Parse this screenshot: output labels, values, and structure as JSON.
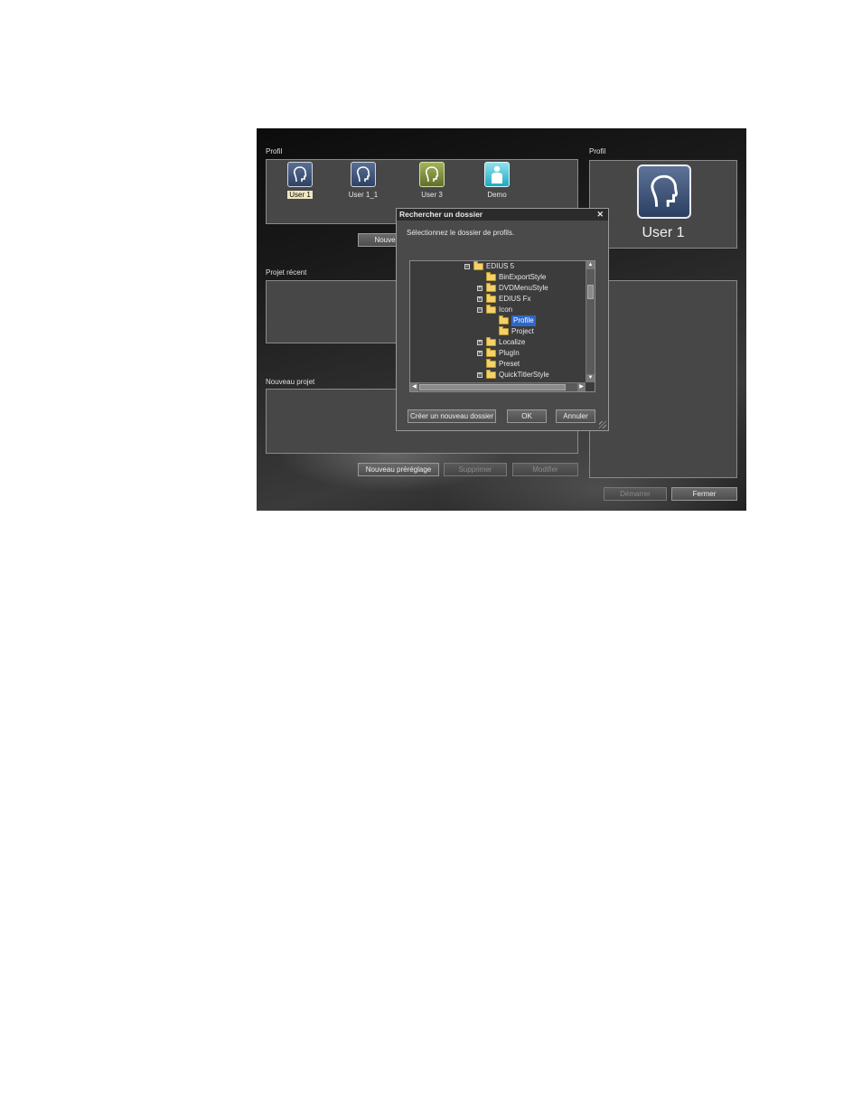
{
  "left_profile": {
    "label": "Profil",
    "items": [
      {
        "label": "User 1",
        "icon": "user-head-icon",
        "color": "#3d5176",
        "selected": true
      },
      {
        "label": "User 1_1",
        "icon": "user-head-icon",
        "color": "#3d5176",
        "selected": false
      },
      {
        "label": "User 3",
        "icon": "user-head-icon",
        "color": "#7c8a3a",
        "selected": false
      },
      {
        "label": "Demo",
        "icon": "person-icon",
        "color": "#2ab3c8",
        "selected": false
      }
    ],
    "new_button": "Nouve"
  },
  "recent": {
    "label": "Projet récent"
  },
  "new_project": {
    "label": "Nouveau projet",
    "buttons": {
      "new_preset": "Nouveau préréglage",
      "delete": "Supprimer",
      "modify": "Modifier"
    }
  },
  "right_profile": {
    "label": "Profil",
    "name": "User 1",
    "icon": "user-head-icon"
  },
  "bottom_buttons": {
    "start": "Démarrer",
    "close": "Fermer"
  },
  "dialog": {
    "title": "Rechercher un dossier",
    "close_glyph": "✕",
    "instruction": "Sélectionnez le dossier de profils.",
    "tree": [
      {
        "label": "EDIUS 5",
        "expander": "−"
      },
      {
        "label": "BinExportStyle",
        "expander": ""
      },
      {
        "label": "DVDMenuStyle",
        "expander": "+"
      },
      {
        "label": "EDIUS Fx",
        "expander": "+"
      },
      {
        "label": "Icon",
        "expander": "−"
      },
      {
        "label": "Profile",
        "expander": "",
        "selected": true
      },
      {
        "label": "Project",
        "expander": ""
      },
      {
        "label": "Localize",
        "expander": "+"
      },
      {
        "label": "PlugIn",
        "expander": "+"
      },
      {
        "label": "Preset",
        "expander": ""
      },
      {
        "label": "QuickTitlerStyle",
        "expander": "+"
      }
    ],
    "buttons": {
      "new_folder": "Créer un nouveau dossier",
      "ok": "OK",
      "cancel": "Annuler"
    }
  }
}
